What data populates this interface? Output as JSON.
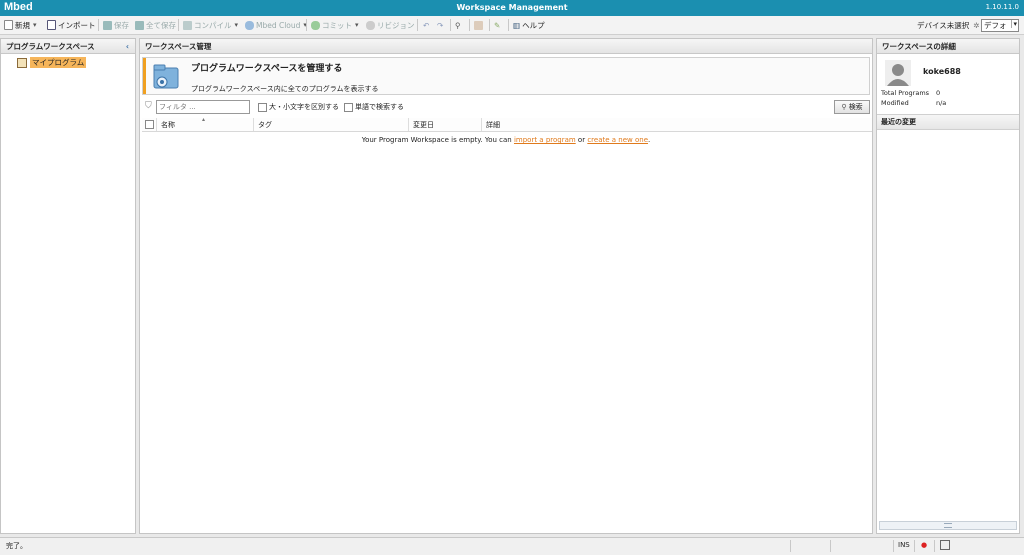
{
  "titlebar": {
    "logo": "Mbed",
    "title": "Workspace Management",
    "version": "1.10.11.0"
  },
  "toolbar": {
    "new": "新規",
    "import": "インポート",
    "save": "保存",
    "save_all": "全て保存",
    "compile": "コンパイル",
    "mbed_cloud": "Mbed Cloud",
    "commit": "コミット",
    "revision": "リビジョン",
    "help": "ヘルプ",
    "device_label": "デバイス未選択",
    "device_select": "デフォ"
  },
  "left_panel": {
    "title": "プログラムワークスペース",
    "items": [
      {
        "label": "マイプログラム"
      }
    ]
  },
  "center_panel": {
    "title": "ワークスペース管理",
    "banner": {
      "heading": "プログラムワークスペースを管理する",
      "desc": "プログラムワークスペース内に全てのプログラムを表示する"
    },
    "filter": {
      "placeholder": "フィルタ ...",
      "case_label": "大・小文字を区別する",
      "word_label": "単語で検索する",
      "search_button": "検索"
    },
    "columns": [
      "名称",
      "タグ",
      "変更日",
      "詳細"
    ],
    "empty": {
      "prefix": "Your Program Workspace is empty. You can ",
      "link1": "import a program",
      "mid": " or ",
      "link2": "create a new one",
      "suffix": "."
    }
  },
  "right_panel": {
    "title": "ワークスペースの詳細",
    "username": "koke688",
    "total_programs_label": "Total Programs",
    "total_programs_value": "0",
    "modified_label": "Modified",
    "modified_value": "n/a",
    "recent_title": "最近の変更"
  },
  "status": {
    "text": "完了。",
    "ins": "INS"
  },
  "colors": {
    "titlebar": "#1b8fb0",
    "accent_orange": "#f0a020",
    "link": "#e07a1c"
  }
}
